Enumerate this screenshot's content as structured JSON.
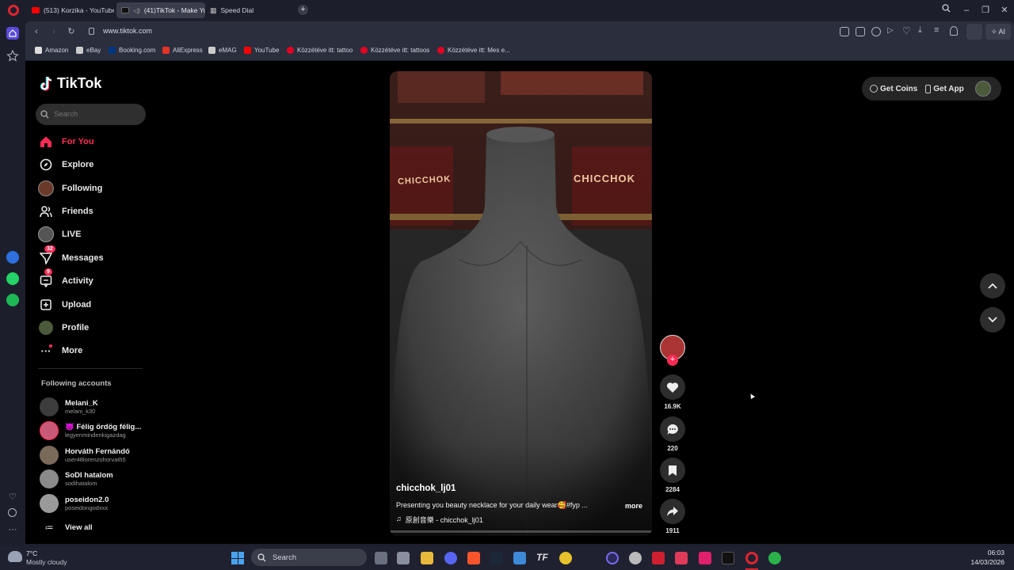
{
  "browser": {
    "tabs": [
      {
        "label": "(513) Korzika - YouTube",
        "icon": "youtube-icon",
        "color": "#ff0000"
      },
      {
        "label": "(41)TikTok - Make Yo...",
        "icon": "tiktok-icon",
        "color": "#111111",
        "active": true
      },
      {
        "label": "Speed Dial",
        "icon": "speed-dial-icon",
        "color": "#aeb3c2"
      }
    ],
    "url": "www.tiktok.com",
    "ai_label": "AI",
    "bookmarks": [
      {
        "label": "Amazon",
        "icon": "amazon-icon"
      },
      {
        "label": "eBay",
        "icon": "ebay-icon"
      },
      {
        "label": "Booking.com",
        "icon": "booking-icon"
      },
      {
        "label": "AliExpress",
        "icon": "aliexpress-icon"
      },
      {
        "label": "eMAG",
        "icon": "emag-icon"
      },
      {
        "label": "YouTube",
        "icon": "youtube-icon"
      },
      {
        "label": "Közzétéve itt: tattoo",
        "icon": "pinterest-icon"
      },
      {
        "label": "Közzétéve itt: tattoos",
        "icon": "pinterest-icon"
      },
      {
        "label": "Közzétéve itt: Mes e...",
        "icon": "pinterest-icon"
      }
    ]
  },
  "tiktok": {
    "logo": "TikTok",
    "search_placeholder": "Search",
    "nav": [
      {
        "label": "For You",
        "icon": "home-icon",
        "active": true
      },
      {
        "label": "Explore",
        "icon": "compass-icon"
      },
      {
        "label": "Following",
        "icon": "following-avatar-icon"
      },
      {
        "label": "Friends",
        "icon": "friends-icon"
      },
      {
        "label": "LIVE",
        "icon": "live-icon"
      },
      {
        "label": "Messages",
        "icon": "messages-icon",
        "badge": "32"
      },
      {
        "label": "Activity",
        "icon": "activity-icon",
        "badge": "9"
      },
      {
        "label": "Upload",
        "icon": "upload-icon"
      },
      {
        "label": "Profile",
        "icon": "profile-avatar-icon"
      },
      {
        "label": "More",
        "icon": "more-icon"
      }
    ],
    "following_title": "Following accounts",
    "following": [
      {
        "name": "Melani_K",
        "handle": "melani_k30"
      },
      {
        "name": "👿 Félig ördög félig...",
        "handle": "legyenmindenkigazdag"
      },
      {
        "name": "Horváth Fernándó",
        "handle": "user48lorenzohorvath5"
      },
      {
        "name": "SoDI hatalom",
        "handle": "sodihatalom"
      },
      {
        "name": "poseidon2.0",
        "handle": "poseidongodxxx"
      }
    ],
    "view_all": "View all",
    "get_coins": "Get Coins",
    "get_app": "Get App",
    "video": {
      "author": "chicchok_lj01",
      "caption": "Presenting you beauty necklace for your daily wear🥰#fyp ...",
      "more": "more",
      "music": "原創音樂 - chicchok_lj01",
      "sign_text": "CHICCHOK",
      "likes": "16.9K",
      "comments": "220",
      "saves": "2284",
      "shares": "1911"
    },
    "accent": "#fe2c55"
  },
  "taskbar": {
    "weather_temp": "7°C",
    "weather_desc": "Mostly cloudy",
    "search_label": "Search",
    "time": "06:03",
    "date": "14/03/2026"
  }
}
